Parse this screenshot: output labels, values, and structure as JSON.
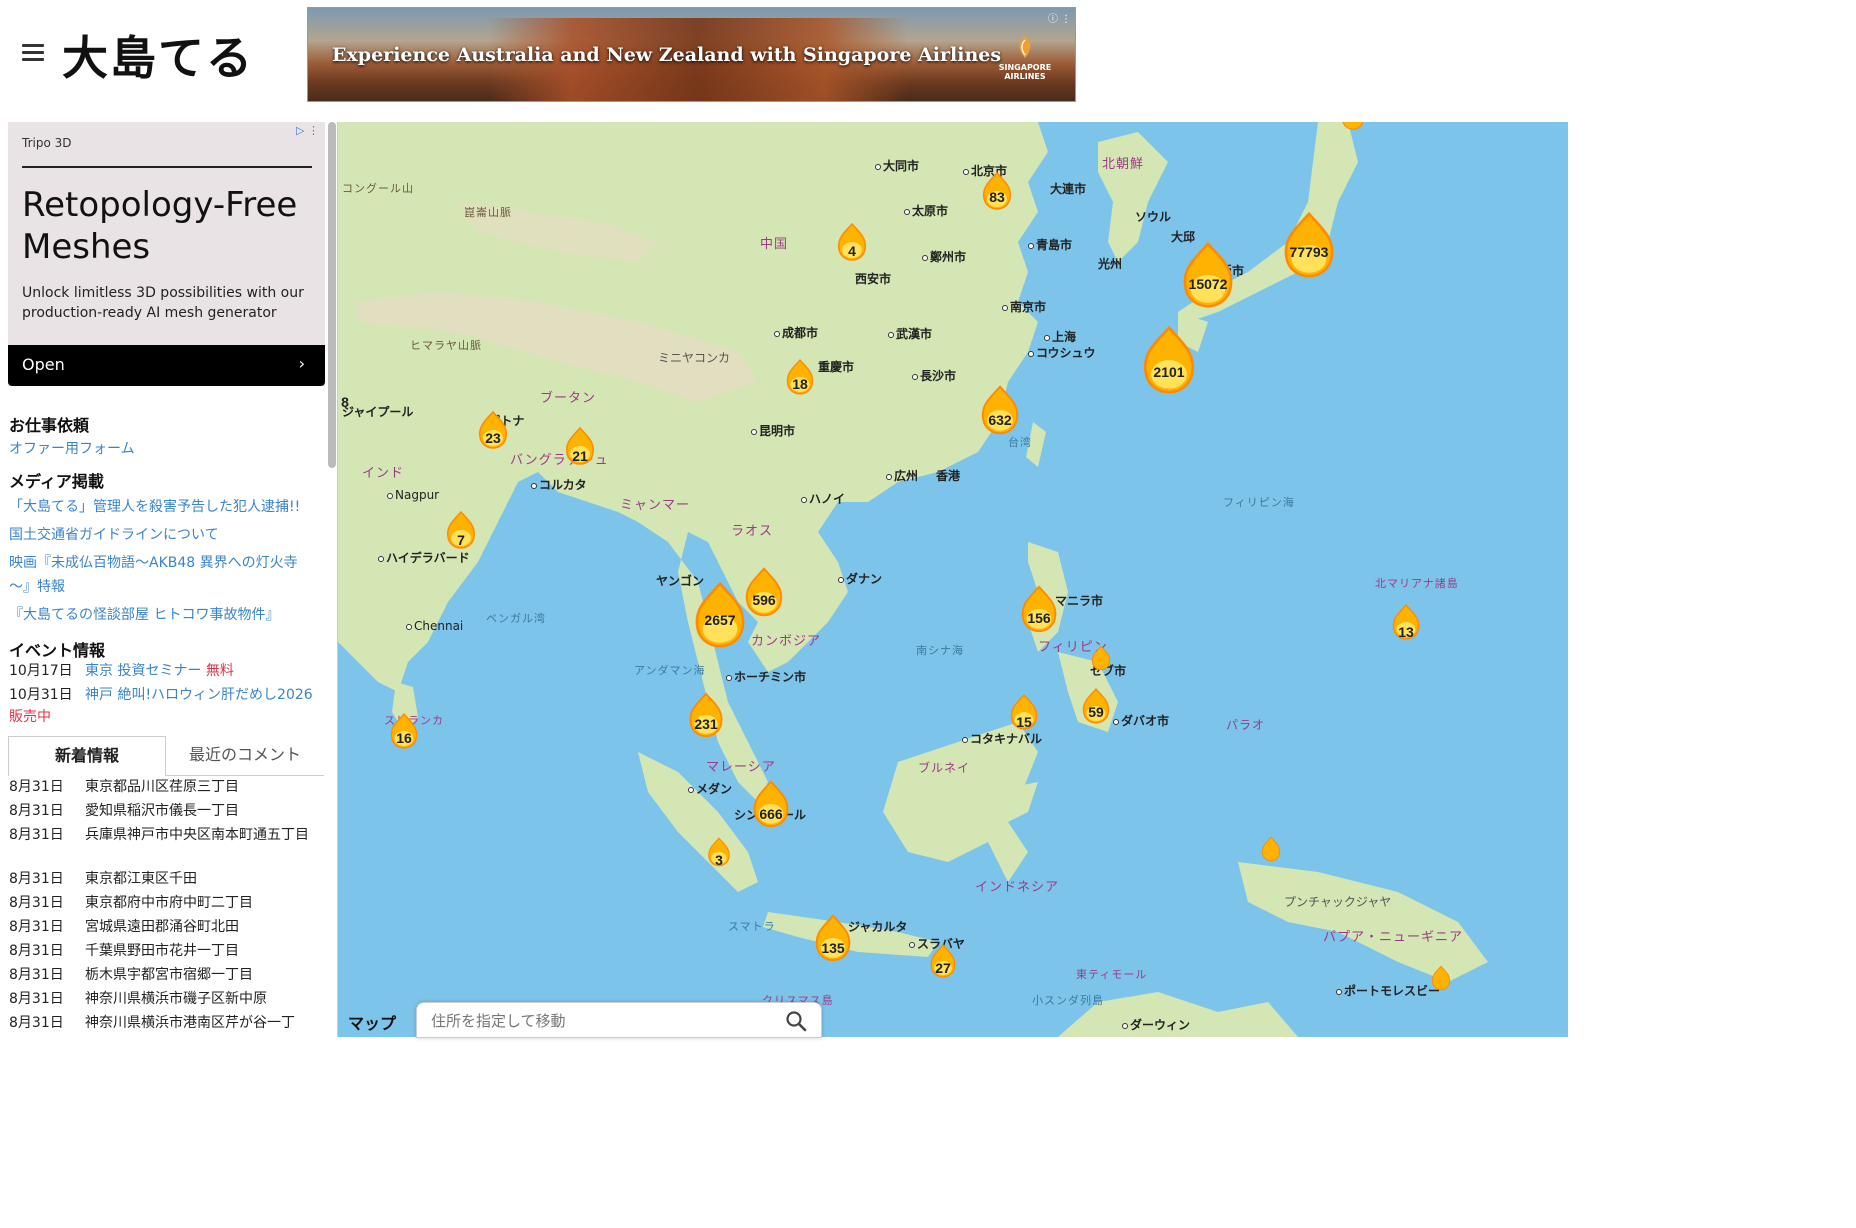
{
  "site": {
    "logo_text": "大島てる"
  },
  "banner_ad": {
    "text": "Experience Australia and New Zealand with Singapore Airlines",
    "brand_line1": "SINGAPORE",
    "brand_line2": "AIRLINES"
  },
  "sidebar_ad": {
    "advertiser": "Tripo 3D",
    "headline": "Retopology-Free Meshes",
    "body": "Unlock limitless 3D possibilities with our production-ready AI mesh generator",
    "cta": "Open"
  },
  "sections": {
    "work_title": "お仕事依頼",
    "work_link": "オファー用フォーム",
    "media_title": "メディア掲載",
    "media_links": [
      "「大島てる」管理人を殺害予告した犯人逮捕!!",
      "国土交通省ガイドラインについて",
      "映画『未成仏百物語〜AKB48 異界への灯火寺",
      "〜』特報",
      "『大島てるの怪談部屋 ヒトコワ事故物件』"
    ],
    "event_title": "イベント情報",
    "events": [
      {
        "date": "10月17日",
        "label": "東京 投資セミナー",
        "tag": "無料"
      },
      {
        "date": "10月31日",
        "label": "神戸 絶叫!ハロウィン肝だめし2026",
        "tag": "販売中"
      }
    ]
  },
  "tabs": {
    "news": "新着情報",
    "comments": "最近のコメント"
  },
  "news": [
    {
      "date": "8月31日",
      "text": "東京都品川区荏原三丁目"
    },
    {
      "date": "8月31日",
      "text": "愛知県稲沢市儀長一丁目"
    },
    {
      "date": "8月31日",
      "text": "兵庫県神戸市中央区南本町通五丁目"
    },
    {
      "date": "8月31日",
      "text": "東京都江東区千田"
    },
    {
      "date": "8月31日",
      "text": "東京都府中市府中町二丁目"
    },
    {
      "date": "8月31日",
      "text": "宮城県遠田郡涌谷町北田"
    },
    {
      "date": "8月31日",
      "text": "千葉県野田市花井一丁目"
    },
    {
      "date": "8月31日",
      "text": "栃木県宇都宮市宿郷一丁目"
    },
    {
      "date": "8月31日",
      "text": "神奈川県横浜市磯子区新中原"
    },
    {
      "date": "8月31日",
      "text": "神奈川県横浜市港南区芹が谷一丁"
    }
  ],
  "map": {
    "attribution": "マップ",
    "search_placeholder": "住所を指定して移動",
    "labels": {
      "datong": "大同市",
      "beijing": "北京市",
      "dalian": "大連市",
      "north_korea": "北朝鮮",
      "taiyuan": "太原市",
      "seoul": "ソウル",
      "daejeon": "大邱",
      "gwangju": "光州",
      "china": "中国",
      "zhengzhou": "鄭州市",
      "qingdao": "青島市",
      "xian": "西安市",
      "osaka": "阪市",
      "nanjing": "南京市",
      "chengdu": "成都市",
      "wuhan": "武漢市",
      "shanghai": "上海",
      "chongqing": "重慶市",
      "hangzhou": "コウシュウ",
      "changsha": "長沙市",
      "minya": "ミニヤコンカ",
      "kunming": "昆明市",
      "bhutan": "ブータン",
      "patna": "パトナ",
      "jaipur": "ジャイプール",
      "bangladesh": "バングラデシュ",
      "kolkata": "コルカタ",
      "india": "インド",
      "nagpur": "Nagpur",
      "guangzhou": "広州",
      "hongkong": "香港",
      "hanoi": "ハノイ",
      "myanmar": "ミャンマー",
      "laos": "ラオス",
      "philippine_sea": "フィリピン海",
      "hyderabad": "ハイデラバード",
      "yangon": "ヤンゴン",
      "danang": "ダナン",
      "manila": "マニラ市",
      "n_mariana": "北マリアナ諸島",
      "chennai": "Chennai",
      "bengal": "ベンガル湾",
      "cambodia": "カンボジア",
      "philippines": "フィリピン",
      "cebu": "セブ市",
      "hcmc": "ホーチミン市",
      "srilanka": "スリランカ",
      "davao": "ダバオ市",
      "palau": "パラオ",
      "kota": "コタキナバル",
      "malaysia": "マレーシア",
      "brunei": "ブルネイ",
      "medan": "メダン",
      "singapore": "シンガポール",
      "indonesia": "インドネシア",
      "puncak": "プンチャックジャヤ",
      "jakarta": "ジャカルタ",
      "surabaya": "スラバヤ",
      "png": "パプア・ニューギニア",
      "timor": "東ティモール",
      "christmas": "クリスマス島",
      "portmoresby": "ポートモレスビー",
      "darwin": "ダーウィン",
      "kunlun": "崑崙山脈",
      "himalaya": "ヒマラヤ山脈",
      "kongur": "コングール山",
      "s_china_sea": "南シナ海",
      "andaman": "アンダマン海",
      "lesser_sunda": "小スンダ列島",
      "taiwan": "台湾",
      "sumatra": "スマトラ",
      "hyderabad2": "ハイデラバード"
    },
    "markers": [
      {
        "id": "beijing",
        "count": "83"
      },
      {
        "id": "xian",
        "count": "4"
      },
      {
        "id": "kyushu",
        "count": "15072"
      },
      {
        "id": "kanto",
        "count": "77793"
      },
      {
        "id": "okinawa",
        "count": "2101"
      },
      {
        "id": "taiwan",
        "count": "632"
      },
      {
        "id": "chongqing",
        "count": "18"
      },
      {
        "id": "patna",
        "count": "23"
      },
      {
        "id": "bangladesh",
        "count": "21"
      },
      {
        "id": "mumbai",
        "count": "8"
      },
      {
        "id": "hyderabad",
        "count": "7"
      },
      {
        "id": "bangkok2",
        "count": "596"
      },
      {
        "id": "bangkok",
        "count": "2657"
      },
      {
        "id": "manila",
        "count": "156"
      },
      {
        "id": "saipan",
        "count": "13"
      },
      {
        "id": "srilanka",
        "count": "16"
      },
      {
        "id": "phuket",
        "count": "231"
      },
      {
        "id": "kotakinabalu",
        "count": "15"
      },
      {
        "id": "davao",
        "count": "59"
      },
      {
        "id": "singapore",
        "count": "666"
      },
      {
        "id": "sumatra",
        "count": "3"
      },
      {
        "id": "jakarta",
        "count": "135"
      },
      {
        "id": "surabaya",
        "count": "27"
      }
    ]
  },
  "colors": {
    "link": "#3a84c9",
    "accent_red": "#e0334a",
    "sea": "#7dc4ea",
    "land": "#cfe3b0"
  }
}
